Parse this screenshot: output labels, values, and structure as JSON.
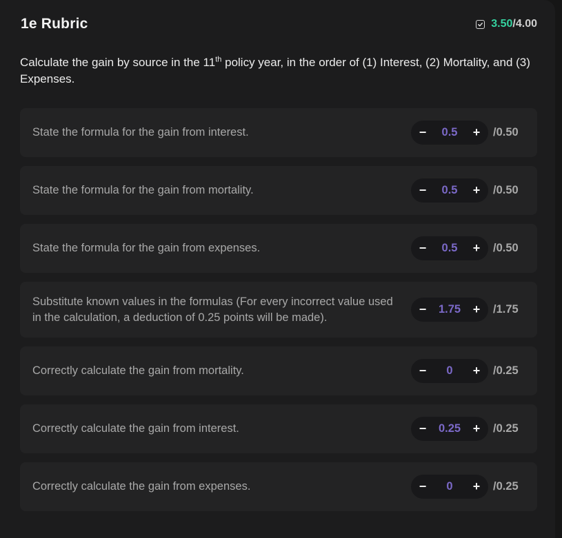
{
  "header": {
    "title": "1e Rubric",
    "score_earned": "3.50",
    "score_total": "/4.00",
    "check_icon": "checkbox-checked-icon"
  },
  "question": {
    "text_before": "Calculate the gain by source in the 11",
    "superscript": "th",
    "text_after": " policy year, in the order of (1) Interest, (2) Mortality, and (3) Expenses."
  },
  "colors": {
    "accent_score": "#35d3a0",
    "stepper_value": "#7b69c8"
  },
  "rubric_items": [
    {
      "label": "State the formula for the gain from interest.",
      "value": "0.5",
      "max": "/0.50"
    },
    {
      "label": "State the formula for the gain from mortality.",
      "value": "0.5",
      "max": "/0.50"
    },
    {
      "label": "State the formula for the gain from expenses.",
      "value": "0.5",
      "max": "/0.50"
    },
    {
      "label": "Substitute known values in the formulas (For every incorrect value used in the calculation, a deduction of 0.25 points will be made).",
      "value": "1.75",
      "max": "/1.75"
    },
    {
      "label": "Correctly calculate the gain from mortality.",
      "value": "0",
      "max": "/0.25"
    },
    {
      "label": "Correctly calculate the gain from interest.",
      "value": "0.25",
      "max": "/0.25"
    },
    {
      "label": "Correctly calculate the gain from expenses.",
      "value": "0",
      "max": "/0.25"
    }
  ],
  "stepper": {
    "decrement_label": "−",
    "increment_label": "+"
  }
}
